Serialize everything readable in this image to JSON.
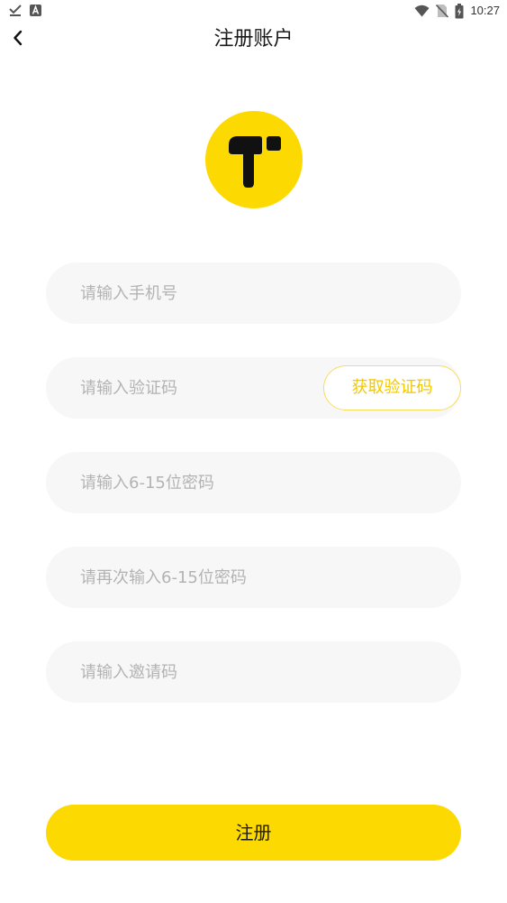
{
  "status_bar": {
    "time": "10:27",
    "icons": [
      "download-done-icon",
      "notification-a-icon",
      "wifi-icon",
      "no-sim-icon",
      "battery-charging-icon"
    ]
  },
  "header": {
    "title": "注册账户",
    "back_icon": "chevron-left-icon"
  },
  "logo": {
    "shape": "letter-t-logo",
    "color": "#fcd900"
  },
  "form": {
    "phone": {
      "placeholder": "请输入手机号",
      "value": ""
    },
    "code": {
      "placeholder": "请输入验证码",
      "value": "",
      "button_label": "获取验证码"
    },
    "password": {
      "placeholder": "请输入6-15位密码",
      "value": ""
    },
    "password_confirm": {
      "placeholder": "请再次输入6-15位密码",
      "value": ""
    },
    "invite": {
      "placeholder": "请输入邀请码",
      "value": ""
    }
  },
  "register": {
    "label": "注册"
  },
  "colors": {
    "accent": "#fcd900",
    "field_background": "#f7f7f7",
    "placeholder_text": "#b3b3b3",
    "code_button_text": "#f2c800"
  }
}
